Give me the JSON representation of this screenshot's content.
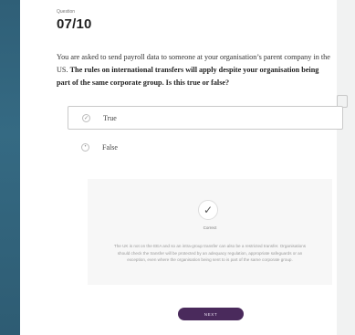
{
  "question": {
    "kicker": "Question",
    "counter": "07/10",
    "text_intro": "You are asked to send payroll data to someone at your organisation’s parent company in the US. ",
    "text_bold": "The rules on international transfers will apply despite your organisation being part of the same corporate group. Is this true or false?"
  },
  "options": [
    {
      "label": "True",
      "selected": true,
      "mark": "✓"
    },
    {
      "label": "False",
      "selected": false,
      "mark": "•"
    }
  ],
  "feedback": {
    "icon": "check-icon",
    "glyph": "✓",
    "label": "Correct",
    "text": "The UK is not on the EEA and so an intra-group transfer can also be a restricted transfer. Organisations should check the transfer will be protected by an adequacy regulation, appropriate safeguards or an exception, even where the organisation being sent to is part of the same corporate group."
  },
  "next_button": {
    "label": "NEXT"
  },
  "colors": {
    "background": "#3d6f87",
    "card": "#ffffff",
    "button": "#4a2a5c"
  }
}
